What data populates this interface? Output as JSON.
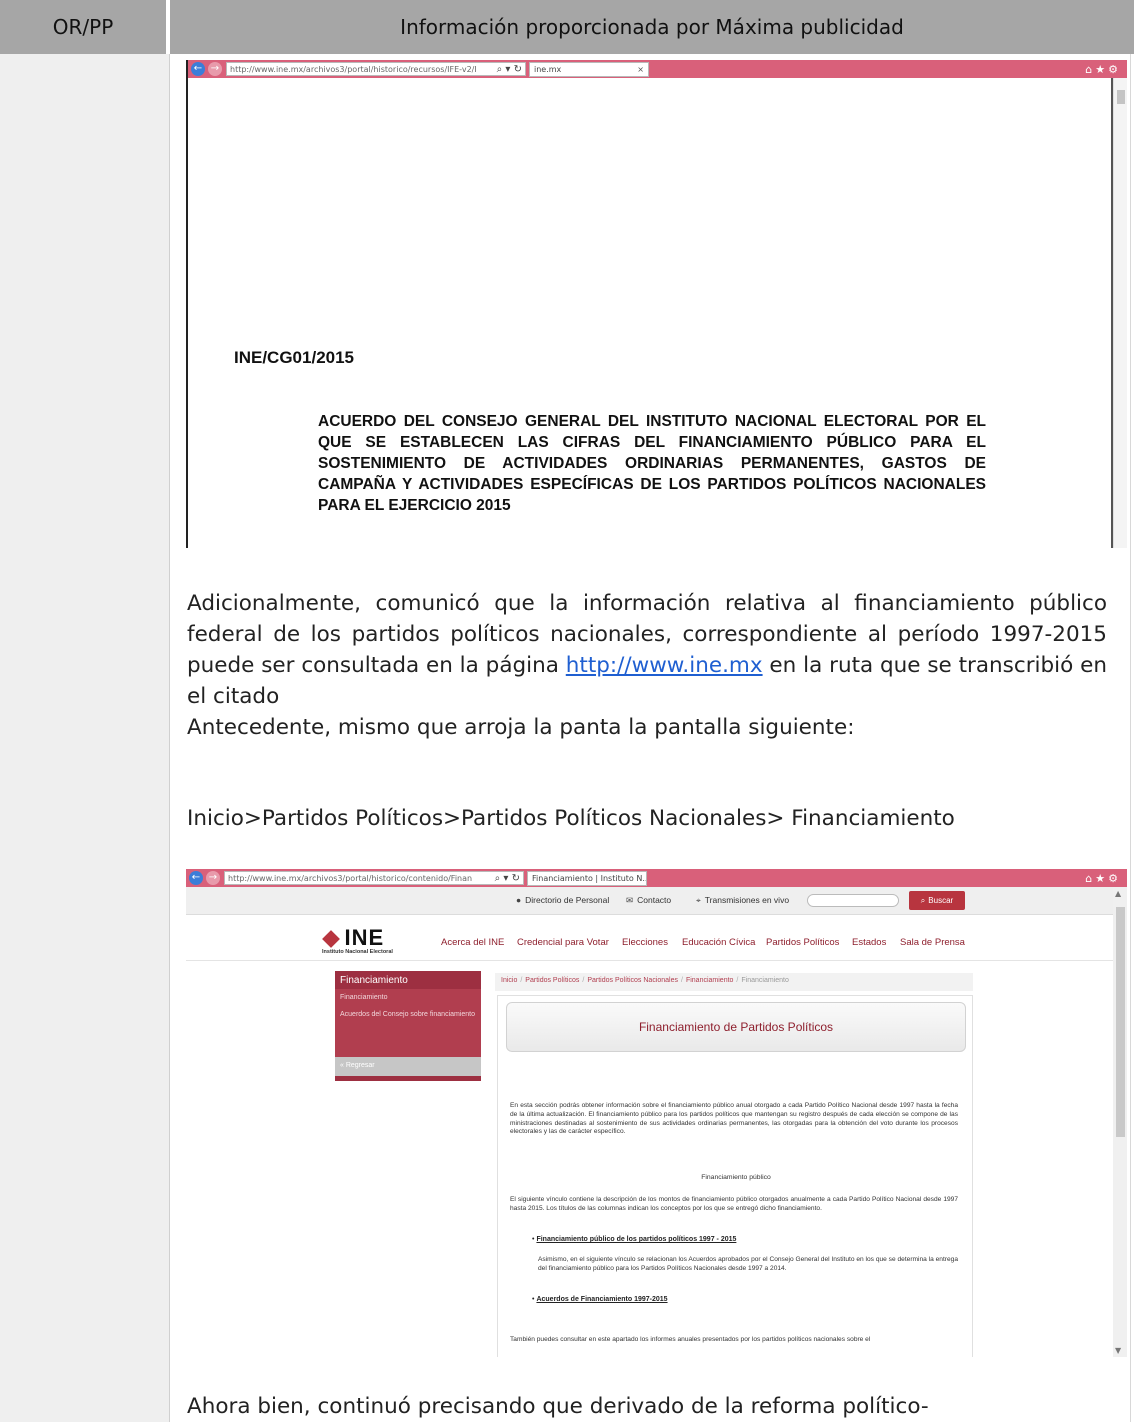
{
  "table": {
    "header_left": "OR/PP",
    "header_right": "Información proporcionada por Máxima publicidad"
  },
  "shot1": {
    "url": "http://www.ine.mx/archivos3/portal/historico/recursos/IFE-v2/I",
    "url_domain": "ine.mx",
    "tab": "ine.mx",
    "doc_id": "INE/CG01/2015",
    "doc_title": "ACUERDO DEL CONSEJO GENERAL DEL INSTITUTO NACIONAL ELECTORAL POR EL QUE SE ESTABLECEN LAS CIFRAS DEL FINANCIAMIENTO PÚBLICO PARA EL SOSTENIMIENTO DE ACTIVIDADES ORDINARIAS PERMANENTES, GASTOS DE CAMPAÑA Y ACTIVIDADES ESPECÍFICAS DE LOS PARTIDOS POLÍTICOS NACIONALES PARA EL EJERCICIO 2015"
  },
  "body": {
    "p1_a": "Adicionalmente, comunicó que la información relativa al financiamiento público federal de los partidos políticos nacionales, correspondiente al período 1997-2015 puede ser consultada en la página",
    "link": "http://www.ine.mx",
    "p1_b": "en la ruta que se transcribió en el citado",
    "p1_c": "Antecedente, mismo que arroja la panta la pantalla siguiente:",
    "path": "Inicio>Partidos Políticos>Partidos Políticos Nacionales> Financiamiento",
    "p3": "Ahora bien, continuó precisando que derivado de la reforma político-"
  },
  "shot2": {
    "url": "http://www.ine.mx/archivos3/portal/historico/contenido/Finan",
    "url_domain": "ine.mx",
    "tab": "Financiamiento | Instituto N...",
    "top": {
      "directorio": "Directorio de Personal",
      "contacto": "Contacto",
      "transmisiones": "Transmisiones en vivo",
      "buscar": "Buscar"
    },
    "logo": "INE",
    "logo_sub": "Instituto Nacional Electoral",
    "menu": [
      "Acerca del INE",
      "Credencial para Votar",
      "Elecciones",
      "Educación Cívica",
      "Partidos Políticos",
      "Estados",
      "Sala de Prensa"
    ],
    "leftnav": {
      "title": "Financiamiento",
      "items": [
        "Financiamiento",
        "Acuerdos del Consejo sobre financiamiento"
      ],
      "back": "« Regresar"
    },
    "breadcrumbs": [
      "Inicio",
      "Partidos Políticos",
      "Partidos Políticos Nacionales",
      "Financiamiento",
      "Financiamiento"
    ],
    "banner": "Financiamiento de Partidos Políticos",
    "intro": "En esta sección podrás obtener información sobre el financiamiento público anual otorgado a cada Partido Político Nacional desde 1997 hasta la fecha de la última actualización. El financiamiento público para los partidos políticos que mantengan su registro después de cada elección se compone de las ministraciones destinadas al sostenimiento de sus actividades ordinarias permanentes, las otorgadas para la obtención del voto durante los procesos electorales y las de carácter específico.",
    "subheading": "Financiamiento público",
    "para2": "El siguiente vínculo contiene la descripción de los montos de financiamiento público otorgados anualmente a cada Partido Político Nacional desde 1997 hasta 2015. Los títulos de las columnas indican los conceptos por los que se entregó dicho financiamiento.",
    "link1": "Financiamiento público de los partidos políticos 1997 - 2015",
    "para3": "Asimismo, en el siguiente vínculo se relacionan los Acuerdos aprobados por el Consejo General del Instituto en los que se determina la entrega del financiamiento público para los Partidos Políticos Nacionales desde 1997 a 2014.",
    "link2": "Acuerdos de Financiamiento 1997-2015",
    "para4": "También puedes consultar en este apartado los informes anuales presentados por los partidos políticos nacionales sobre el"
  },
  "colors": {
    "header_bg": "#a6a6a6",
    "browser_bar": "#d9607a",
    "ine_red": "#b13e4f",
    "link_blue": "#1f5fd1"
  }
}
